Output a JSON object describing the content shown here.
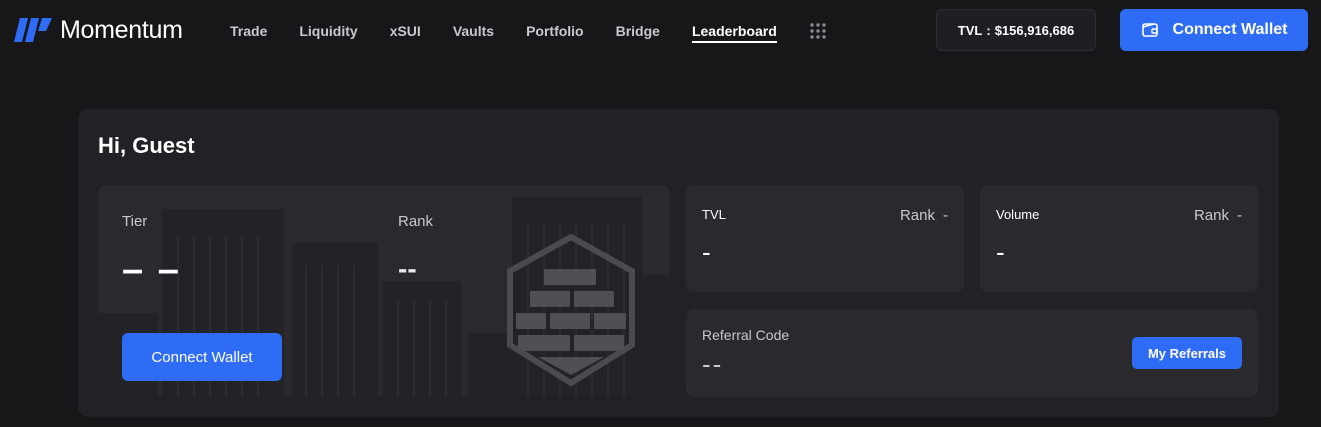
{
  "header": {
    "brand": "Momentum",
    "nav": [
      {
        "label": "Trade",
        "active": false
      },
      {
        "label": "Liquidity",
        "active": false
      },
      {
        "label": "xSUI",
        "active": false
      },
      {
        "label": "Vaults",
        "active": false
      },
      {
        "label": "Portfolio",
        "active": false
      },
      {
        "label": "Bridge",
        "active": false
      },
      {
        "label": "Leaderboard",
        "active": true
      }
    ],
    "more_icon": "grid-dots-icon",
    "tvl_label": "TVL",
    "tvl_separator": ":",
    "tvl_value": "$156,916,686",
    "connect_label": "Connect Wallet",
    "wallet_icon": "wallet-icon"
  },
  "profile": {
    "greeting": "Hi, Guest",
    "tier_label": "Tier",
    "tier_value": "– –",
    "rank_label": "Rank",
    "rank_value": "--",
    "connect_label": "Connect Wallet",
    "badge_icon": "tier-badge-icon"
  },
  "stats": {
    "tvl": {
      "title": "TVL",
      "rank_label": "Rank",
      "rank_value": "-",
      "value": "-"
    },
    "volume": {
      "title": "Volume",
      "rank_label": "Rank",
      "rank_value": "-",
      "value": "-"
    }
  },
  "referral": {
    "title": "Referral Code",
    "value": "--",
    "button_label": "My Referrals"
  },
  "colors": {
    "background": "#17171a",
    "card": "#222226",
    "inner_card": "#2a2a2e",
    "accent": "#2f6cf6"
  }
}
